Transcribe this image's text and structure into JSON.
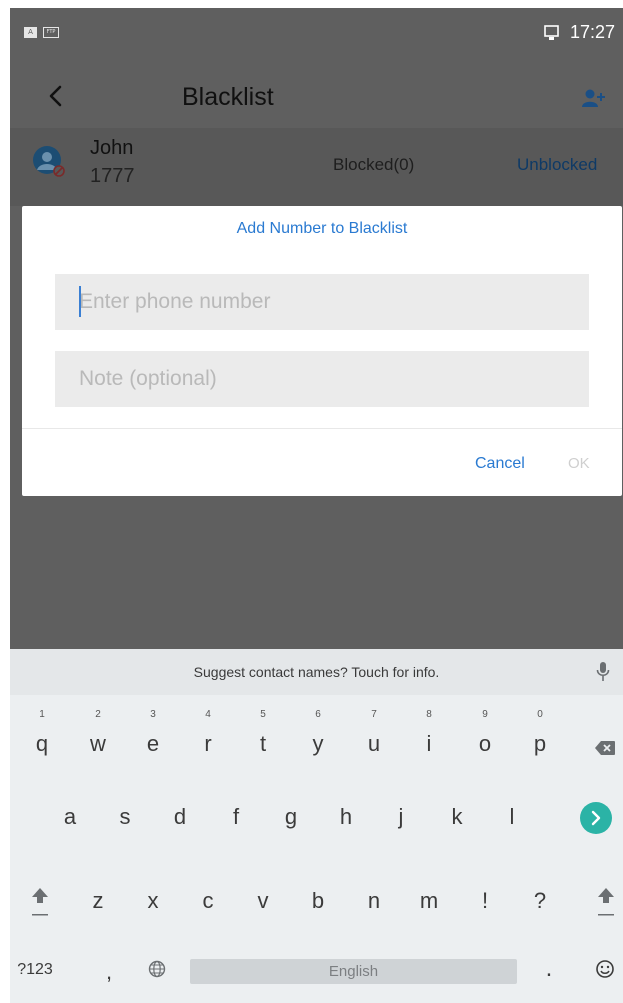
{
  "status_bar": {
    "indicator_a": "A",
    "indicator_ftp": "FTP",
    "time": "17:27"
  },
  "toolbar": {
    "title": "Blacklist"
  },
  "blacklist_row": {
    "name": "John",
    "number": "1777",
    "blocked": "Blocked(0)",
    "action": "Unblocked"
  },
  "dialog": {
    "title": "Add Number to Blacklist",
    "phone_placeholder": "Enter phone number",
    "note_placeholder": "Note (optional)",
    "cancel_label": "Cancel",
    "ok_label": "OK"
  },
  "keyboard": {
    "suggestion": "Suggest contact names? Touch for info.",
    "row1": [
      {
        "ch": "q",
        "hint": "1"
      },
      {
        "ch": "w",
        "hint": "2"
      },
      {
        "ch": "e",
        "hint": "3"
      },
      {
        "ch": "r",
        "hint": "4"
      },
      {
        "ch": "t",
        "hint": "5"
      },
      {
        "ch": "y",
        "hint": "6"
      },
      {
        "ch": "u",
        "hint": "7"
      },
      {
        "ch": "i",
        "hint": "8"
      },
      {
        "ch": "o",
        "hint": "9"
      },
      {
        "ch": "p",
        "hint": "0"
      }
    ],
    "row2": [
      "a",
      "s",
      "d",
      "f",
      "g",
      "h",
      "j",
      "k",
      "l"
    ],
    "row3": [
      "z",
      "x",
      "c",
      "v",
      "b",
      "n",
      "m",
      "!",
      "?"
    ],
    "symbols_label": "?123",
    "comma": ",",
    "space_label": "English",
    "period": "."
  },
  "colors": {
    "accent": "#2a7ad1",
    "enter_key": "#2bb3a6",
    "dim_overlay": "#5f5f5f"
  },
  "icons": [
    "back-arrow-icon",
    "add-contact-icon",
    "contact-blocked-icon",
    "backspace-icon",
    "enter-icon",
    "shift-icon",
    "globe-icon",
    "emoji-icon",
    "mic-icon",
    "monitor-icon"
  ]
}
